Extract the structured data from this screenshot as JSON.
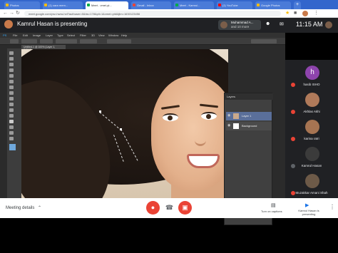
{
  "browser": {
    "tabs": [
      {
        "label": "Photos",
        "active": false
      },
      {
        "label": "(1) cara mem...",
        "active": false
      },
      {
        "label": "Meet - vmei-yt...",
        "active": true
      },
      {
        "label": "Gmail - Inbox",
        "active": false
      },
      {
        "label": "Meet - Kamrul...",
        "active": false
      },
      {
        "label": "(1) YouTube",
        "active": false
      },
      {
        "label": "Google Photos",
        "active": false
      }
    ],
    "url": "meet.google.com/ynz-hwra-hxf?authuser=0&hs=178&pli=1&vmei=ytd&ijlm=1630123456",
    "back_icon": "back-arrow-icon",
    "forward_icon": "forward-arrow-icon",
    "reload_icon": "reload-icon"
  },
  "meet": {
    "presenting_text": "Kamrul Hasan is presenting",
    "chip_line1": "Muhammad A...",
    "chip_line2": "and 10 more",
    "time": "11:15 AM",
    "meeting_details": "Meeting details",
    "turn_on_captions": "Turn on captions",
    "presenting_label": "Kamrul Hasan is presenting"
  },
  "photoshop": {
    "menus": [
      "PS",
      "File",
      "Edit",
      "Image",
      "Layer",
      "Type",
      "Select",
      "Filter",
      "3D",
      "View",
      "Window",
      "Help"
    ],
    "doc_tab": "Untitled-1 @ 100% (Layer 1, RGB/8)",
    "layers_title": "Layers",
    "layers": [
      {
        "name": "Layer 1",
        "selected": true
      },
      {
        "name": "Background",
        "selected": false
      }
    ]
  },
  "participants": [
    {
      "initial": "h",
      "name": "hasib ISHO",
      "color": "#8e44ad"
    },
    {
      "initial": "",
      "name": "Akhlas Akhi",
      "color": "#b07a5a"
    },
    {
      "initial": "",
      "name": "karina ratri",
      "color": "#a67452"
    },
    {
      "initial": "",
      "name": "Kamrul Hasan",
      "color": "#3b3b3b"
    },
    {
      "initial": "",
      "name": "Muzakkar Amani Shah",
      "color": "#6d5a48"
    }
  ],
  "colors": {
    "end_call": "#ea4335",
    "tabbar": "#3366cc"
  }
}
